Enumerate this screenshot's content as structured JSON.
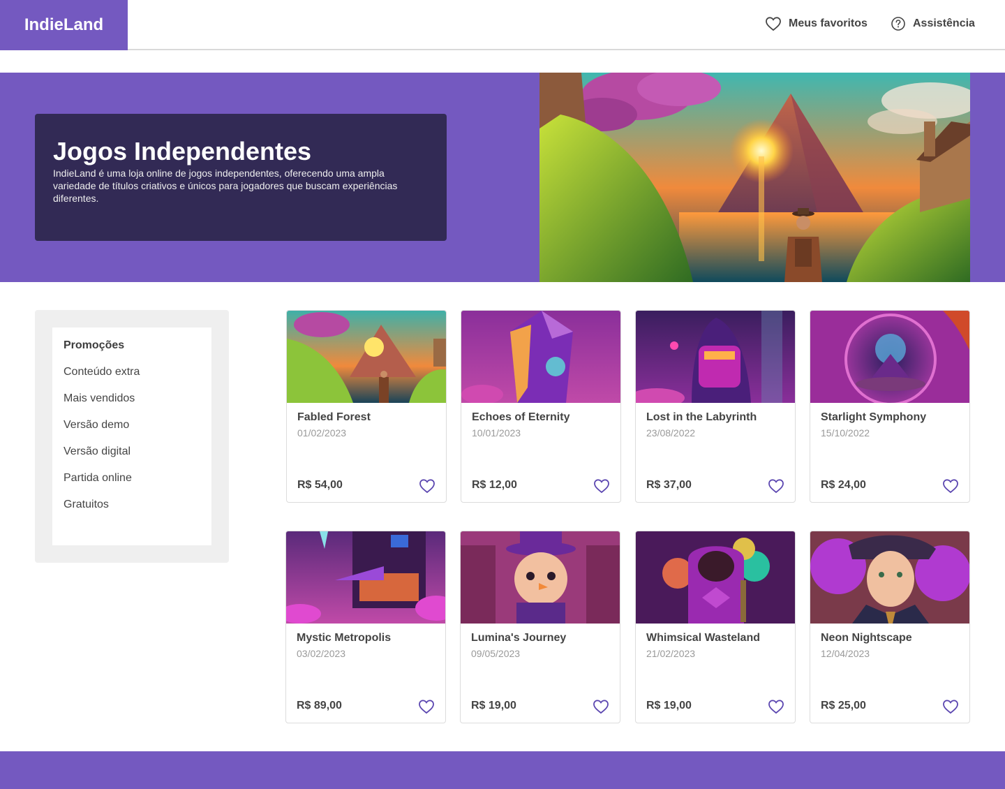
{
  "header": {
    "logo": "IndieLand",
    "favorites_label": "Meus favoritos",
    "help_label": "Assistência"
  },
  "hero": {
    "title": "Jogos Independentes",
    "description": "IndieLand é uma loja online de jogos independentes, oferecendo uma ampla variedade de títulos criativos e únicos para jogadores que buscam experiências diferentes."
  },
  "sidebar": {
    "items": [
      {
        "label": "Promoções"
      },
      {
        "label": "Conteúdo extra"
      },
      {
        "label": "Mais vendidos"
      },
      {
        "label": "Versão demo"
      },
      {
        "label": "Versão digital"
      },
      {
        "label": "Partida online"
      },
      {
        "label": "Gratuitos"
      }
    ]
  },
  "games": [
    {
      "title": "Fabled Forest",
      "date": "01/02/2023",
      "price": "R$ 54,00"
    },
    {
      "title": "Echoes of Eternity",
      "date": "10/01/2023",
      "price": "R$ 12,00"
    },
    {
      "title": "Lost in the Labyrinth",
      "date": "23/08/2022",
      "price": "R$ 37,00"
    },
    {
      "title": "Starlight Symphony",
      "date": "15/10/2022",
      "price": "R$ 24,00"
    },
    {
      "title": "Mystic Metropolis",
      "date": "03/02/2023",
      "price": "R$ 89,00"
    },
    {
      "title": "Lumina's Journey",
      "date": "09/05/2023",
      "price": "R$ 19,00"
    },
    {
      "title": "Whimsical Wasteland",
      "date": "21/02/2023",
      "price": "R$ 19,00"
    },
    {
      "title": "Neon Nightscape",
      "date": "12/04/2023",
      "price": "R$ 25,00"
    }
  ],
  "colors": {
    "brand": "#7459c0",
    "hero_card": "#322a55",
    "heart": "#5b46b0"
  }
}
